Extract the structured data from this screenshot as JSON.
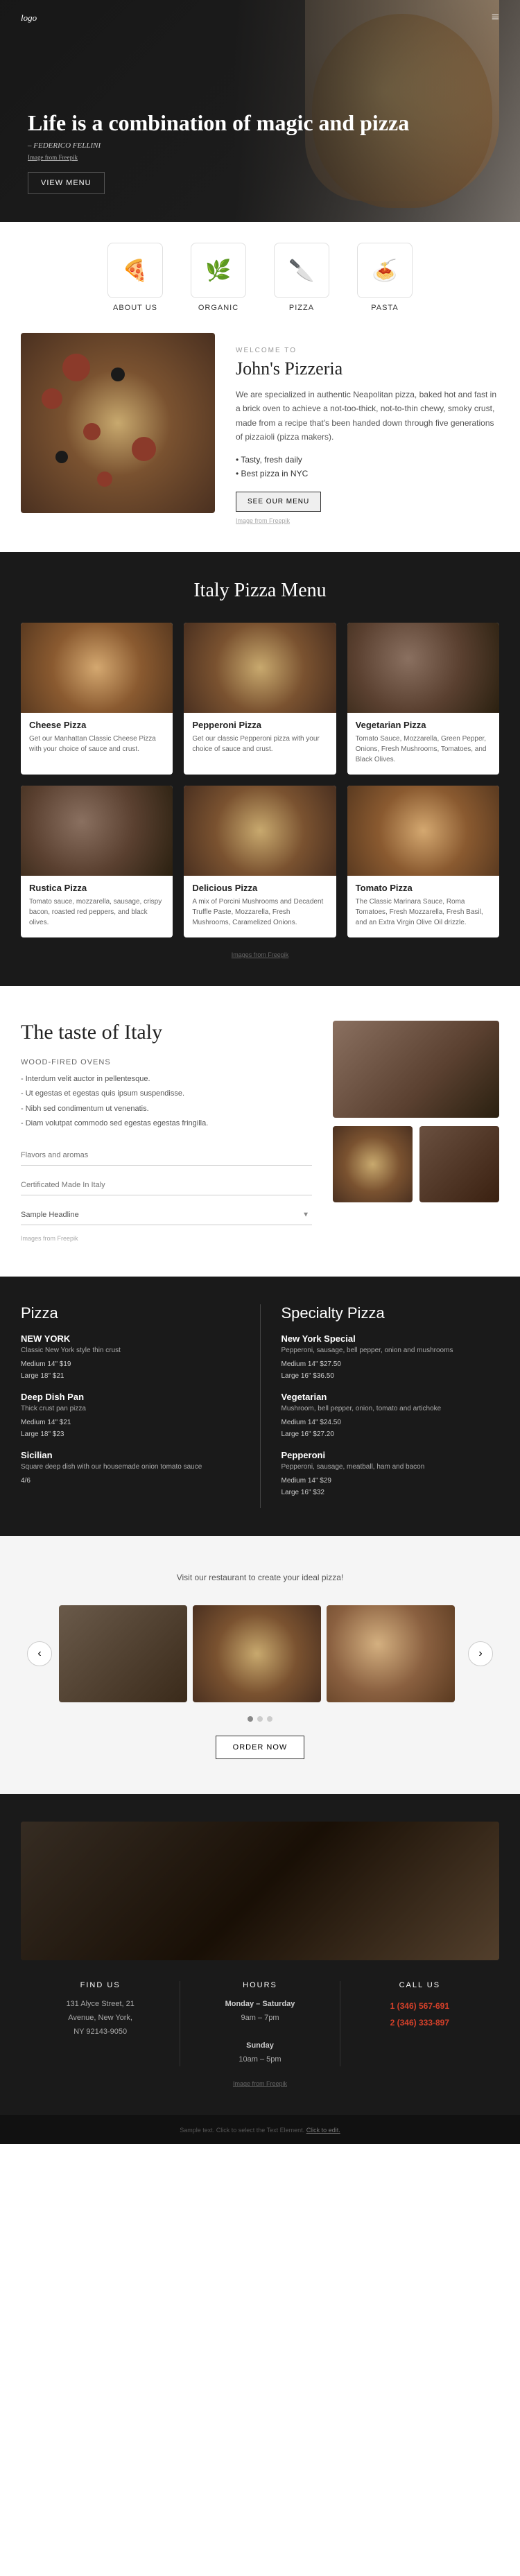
{
  "nav": {
    "logo": "logo",
    "hamburger": "≡"
  },
  "hero": {
    "title": "Life is a combination of magic and pizza",
    "subtitle": "– FEDERICO FELLINI",
    "image_credit": "Image from Freepik",
    "image_credit_link": "#",
    "btn_label": "VIEW MENU"
  },
  "categories": [
    {
      "id": "about-us",
      "icon": "🍕",
      "label": "ABOUT US"
    },
    {
      "id": "organic",
      "icon": "🌿",
      "label": "ORGANIC"
    },
    {
      "id": "pizza",
      "icon": "🔪",
      "label": "PIZZA"
    },
    {
      "id": "pasta",
      "icon": "🍜",
      "label": "PASTA"
    }
  ],
  "welcome": {
    "label": "WELCOME TO",
    "title": "John's Pizzeria",
    "desc": "We are specialized in authentic Neapolitan pizza, baked hot and fast in a brick oven to achieve a not-too-thick, not-to-thin chewy, smoky crust, made from a recipe that's been handed down through five generations of pizzaioli (pizza makers).",
    "list": [
      "Tasty, fresh daily",
      "Best pizza in NYC"
    ],
    "btn_label": "SEE OUR MENU",
    "image_credit": "Image from Freepik",
    "image_credit_link": "#"
  },
  "pizza_menu": {
    "title": "Italy Pizza Menu",
    "items": [
      {
        "name": "Cheese Pizza",
        "desc": "Get our Manhattan Classic Cheese Pizza with your choice of sauce and crust.",
        "img_class": "medium"
      },
      {
        "name": "Pepperoni Pizza",
        "desc": "Get our classic Pepperoni pizza with your choice of sauce and crust.",
        "img_class": ""
      },
      {
        "name": "Vegetarian Pizza",
        "desc": "Tomato Sauce, Mozzarella, Green Pepper, Onions, Fresh Mushrooms, Tomatoes, and Black Olives.",
        "img_class": "dark"
      },
      {
        "name": "Rustica Pizza",
        "desc": "Tomato sauce, mozzarella, sausage, crispy bacon, roasted red peppers, and black olives.",
        "img_class": "dark"
      },
      {
        "name": "Delicious Pizza",
        "desc": "A mix of Porcini Mushrooms and Decadent Truffle Paste, Mozzarella, Fresh Mushrooms, Caramelized Onions.",
        "img_class": ""
      },
      {
        "name": "Tomato Pizza",
        "desc": "The Classic Marinara Sauce, Roma Tomatoes, Fresh Mozzarella, Fresh Basil, and an Extra Virgin Olive Oil drizzle.",
        "img_class": "medium"
      }
    ],
    "image_credit": "Images from Freepik",
    "image_credit_link": "#"
  },
  "taste": {
    "title": "The taste of Italy",
    "wood_fired_label": "Wood-fired ovens",
    "list_items": [
      "Interdum velit auctor in pellentesque.",
      "Ut egestas et egestas quis ipsum suspendisse.",
      "Nibh sed condimentum ut venenatis.",
      "Diam volutpat commodo sed egestas egestas fringilla."
    ],
    "flavors_label": "Flavors and aromas",
    "flavors_placeholder": "Flavors and aromas",
    "certified_label": "Certificated Made In Italy",
    "certified_placeholder": "Certificated Made In Italy",
    "sample_label": "Sample Headline",
    "image_credit": "Images from Freepik",
    "image_credit_link": "#"
  },
  "specialty": {
    "pizza_title": "Pizza",
    "specialty_title": "Specialty Pizza",
    "pizza_types": [
      {
        "name": "NEW YORK",
        "desc": "Classic New York style thin crust",
        "prices": [
          "Medium 14\" $19",
          "Large 18\" $21"
        ]
      },
      {
        "name": "Deep Dish Pan",
        "desc": "Thick crust pan pizza",
        "prices": [
          "Medium 14\" $21",
          "Large 18\" $23"
        ]
      },
      {
        "name": "Sicilian",
        "desc": "Square deep dish with our housemade onion tomato sauce",
        "prices": [
          "4/6"
        ]
      }
    ],
    "specialty_types": [
      {
        "name": "New York Special",
        "desc": "Pepperoni, sausage, bell pepper, onion and mushrooms",
        "prices": [
          "Medium 14\" $27.50",
          "Large 16\" $36.50"
        ]
      },
      {
        "name": "Vegetarian",
        "desc": "Mushroom, bell pepper, onion, tomato and artichoke",
        "prices": [
          "Medium 14\" $24.50",
          "Large 16\" $27.20"
        ]
      },
      {
        "name": "Pepperoni",
        "desc": "Pepperoni, sausage, meatball, ham and bacon",
        "prices": [
          "Medium 14\" $29",
          "Large 16\" $32"
        ]
      }
    ]
  },
  "gallery": {
    "heading_text": "Visit our restaurant to create your ideal pizza!",
    "desc": "Visit our restaurant to create your ideal pizza!",
    "prev_btn": "‹",
    "next_btn": "›",
    "order_btn": "ORDER NOW",
    "dots": [
      true,
      false,
      false
    ]
  },
  "footer": {
    "find_us_title": "FIND US",
    "find_us_address": "131 Alyce Street, 21\nAvenue, New York,\nNY 92143-9050",
    "hours_title": "HOURS",
    "hours_weekday_label": "Monday – Saturday",
    "hours_weekday": "9am – 7pm",
    "hours_sunday_label": "Sunday",
    "hours_sunday": "10am – 5pm",
    "call_us_title": "CALL US",
    "phone1": "1 (346) 567-691",
    "phone2": "2 (346) 333-897",
    "image_credit": "Image from Freepik",
    "image_credit_link": "#"
  },
  "footer_bar": {
    "text": "Sample text. Click to select the Text Element."
  }
}
